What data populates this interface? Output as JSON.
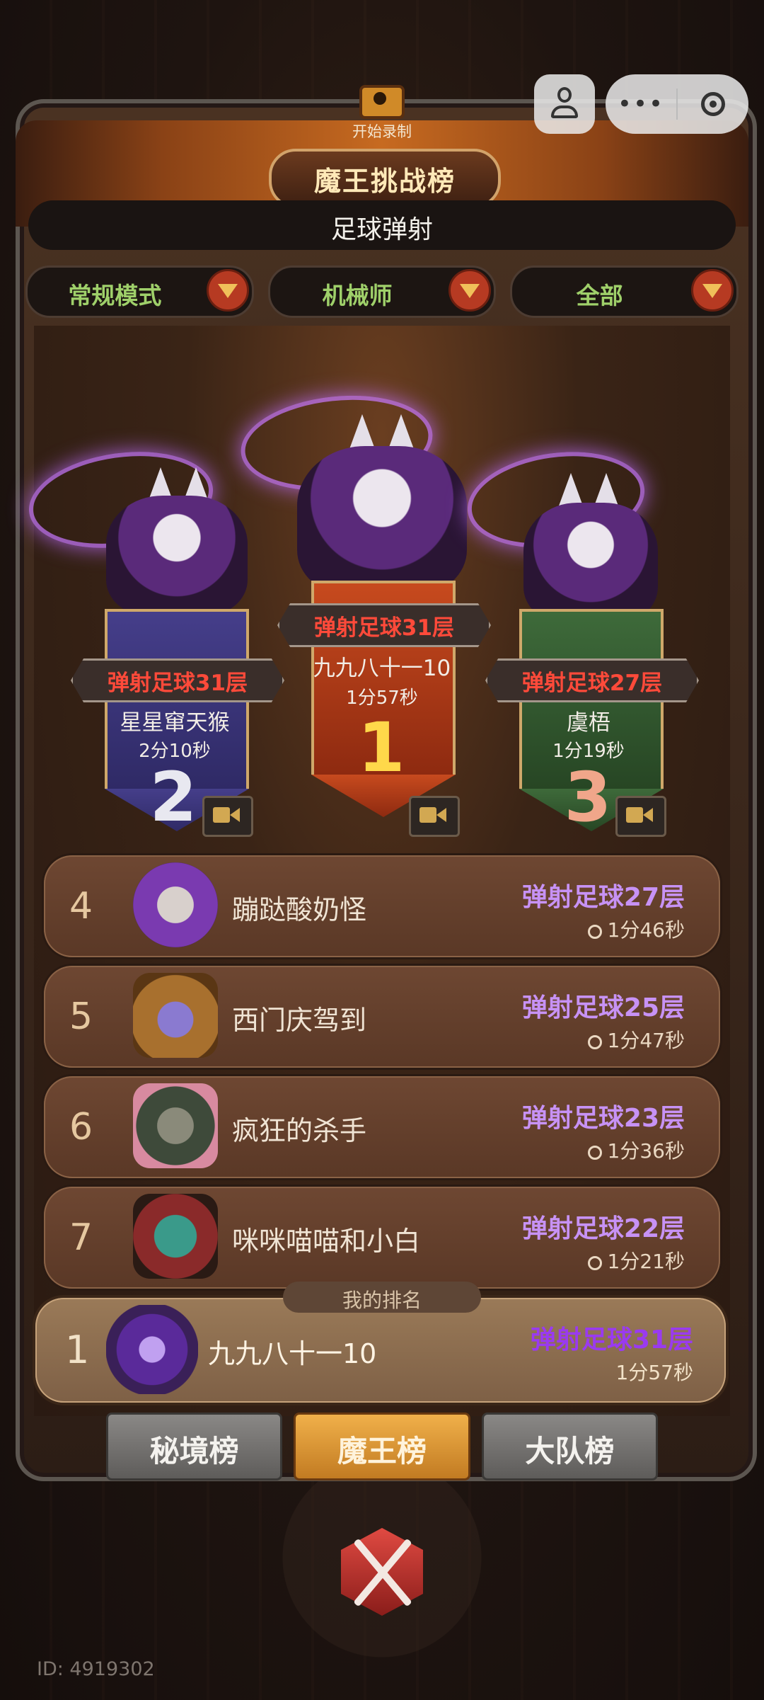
{
  "record": {
    "label": "开始录制"
  },
  "header": {
    "title": "魔王挑战榜",
    "subtitle": "足球弹射"
  },
  "filters": [
    {
      "label": "常规模式"
    },
    {
      "label": "机械师"
    },
    {
      "label": "全部"
    }
  ],
  "podium": {
    "first": {
      "rank": "1",
      "level": "弹射足球31层",
      "name": "九九八十一10",
      "time": "1分57秒"
    },
    "second": {
      "rank": "2",
      "level": "弹射足球31层",
      "name": "星星窜天猴",
      "time": "2分10秒"
    },
    "third": {
      "rank": "3",
      "level": "弹射足球27层",
      "name": "虞梧",
      "time": "1分19秒"
    }
  },
  "list": [
    {
      "rank": "4",
      "name": "蹦跶酸奶怪",
      "level": "弹射足球27层",
      "time": "1分46秒"
    },
    {
      "rank": "5",
      "name": "西门庆驾到",
      "level": "弹射足球25层",
      "time": "1分47秒"
    },
    {
      "rank": "6",
      "name": "疯狂的杀手",
      "level": "弹射足球23层",
      "time": "1分36秒"
    },
    {
      "rank": "7",
      "name": "咪咪喵喵和小白",
      "level": "弹射足球22层",
      "time": "1分21秒"
    }
  ],
  "mine": {
    "tag": "我的排名",
    "rank": "1",
    "name": "九九八十一10",
    "level": "弹射足球31层",
    "time": "1分57秒"
  },
  "tabs": [
    {
      "label": "秘境榜"
    },
    {
      "label": "魔王榜"
    },
    {
      "label": "大队榜"
    }
  ],
  "footer": {
    "id": "ID: 4919302"
  },
  "colors": {
    "accent_green": "#9fd06a",
    "level_red": "#ff4a3a",
    "level_purple": "#c792f5",
    "tab_active": "#e09a38"
  }
}
